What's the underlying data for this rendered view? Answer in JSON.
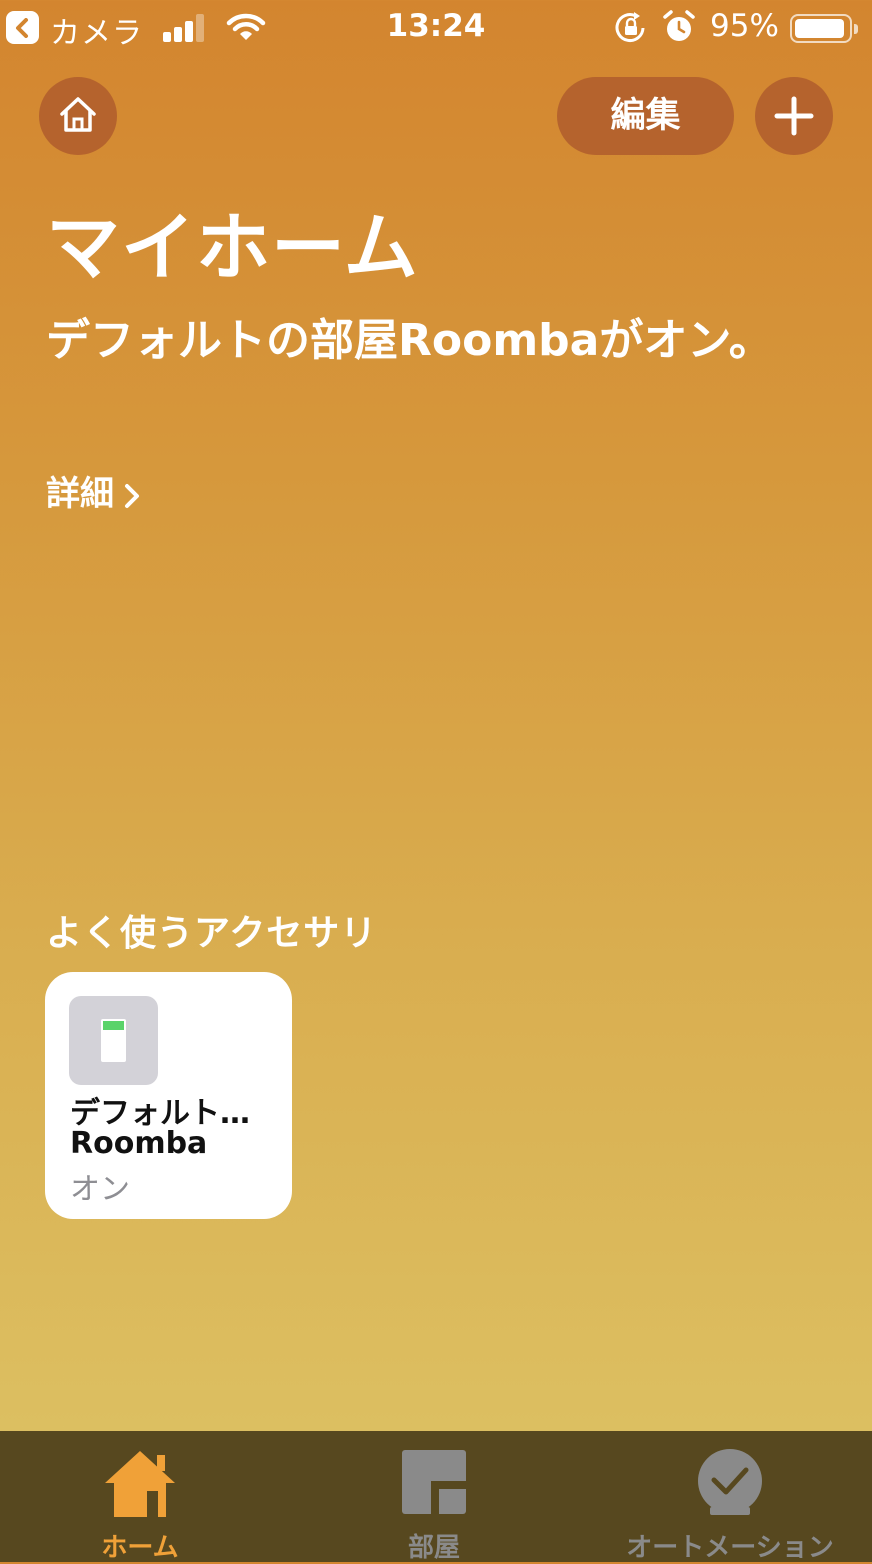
{
  "status_bar": {
    "back_app": "カメラ",
    "time": "13:24",
    "battery_percent": "95%",
    "battery_level": 0.95,
    "signal_bars_active": 3,
    "signal_bars_total": 4
  },
  "header": {
    "edit_label": "編集",
    "home_icon": "house-icon",
    "add_icon": "plus-icon"
  },
  "home": {
    "title": "マイホーム",
    "status_line": "デフォルトの部屋Roombaがオン。",
    "details_label": "詳細"
  },
  "favorites": {
    "section_title": "よく使うアクセサリ",
    "tiles": [
      {
        "room": "デフォルト…",
        "name": "Roomba",
        "state": "オン",
        "icon": "smart-plug-icon"
      }
    ]
  },
  "tab_bar": {
    "tabs": [
      {
        "label": "ホーム",
        "icon": "house-icon",
        "active": true
      },
      {
        "label": "部屋",
        "icon": "rooms-icon",
        "active": false
      },
      {
        "label": "オートメーション",
        "icon": "automation-clock-icon",
        "active": false
      }
    ]
  },
  "colors": {
    "accent": "#f0a138",
    "button_bg": "#b5632d",
    "tab_bar_bg": "#57481f",
    "plug_on": "#5ad36a",
    "inactive_tab": "#8a8a8a"
  }
}
